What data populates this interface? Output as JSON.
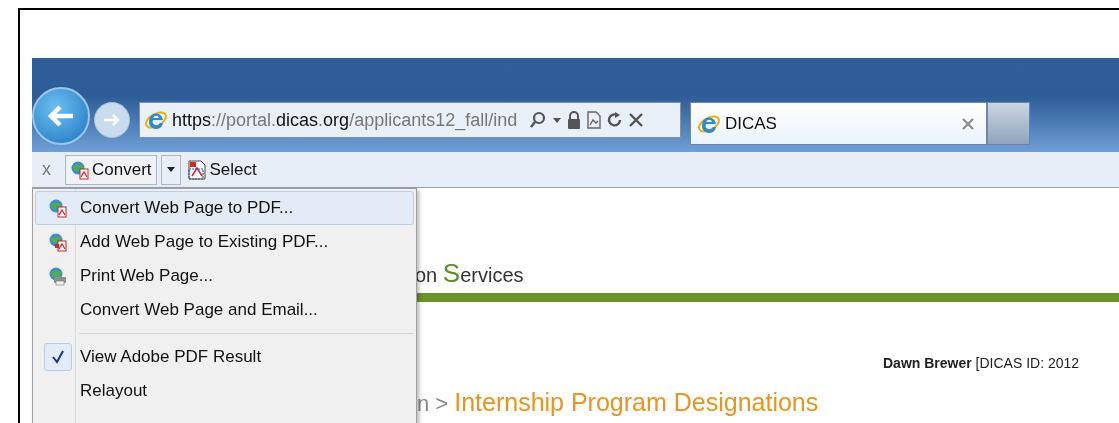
{
  "address_bar": {
    "url": "**https**://portal.**dicas**.**org**/applicants12_fall/ind"
  },
  "tabs": [
    {
      "title": "DICAS",
      "selected": true
    }
  ],
  "toolbar": {
    "close": "x",
    "convert": "Convert",
    "select": "Select"
  },
  "menu": {
    "items": [
      {
        "kind": "convert",
        "label": "Convert Web Page to PDF...",
        "selected": true
      },
      {
        "kind": "add",
        "label": "Add Web Page to Existing PDF...",
        "selected": false
      },
      {
        "kind": "print",
        "label": "Print Web Page...",
        "selected": false
      },
      {
        "kind": "action",
        "label": "Convert Web Page and Email...",
        "selected": false
      },
      {
        "kind": "separator"
      },
      {
        "kind": "toggle",
        "label": "View Adobe PDF Result",
        "checked": true,
        "selected": false
      },
      {
        "kind": "toggle",
        "label": "Relayout",
        "checked": false,
        "selected": false
      }
    ]
  },
  "page": {
    "site_title": "on **S**ervices",
    "user": "**Dawn Brewer** [DICAS ID: 2012",
    "breadcrumb_prefix": "n >",
    "breadcrumb_current": "Internship Program Designations"
  }
}
